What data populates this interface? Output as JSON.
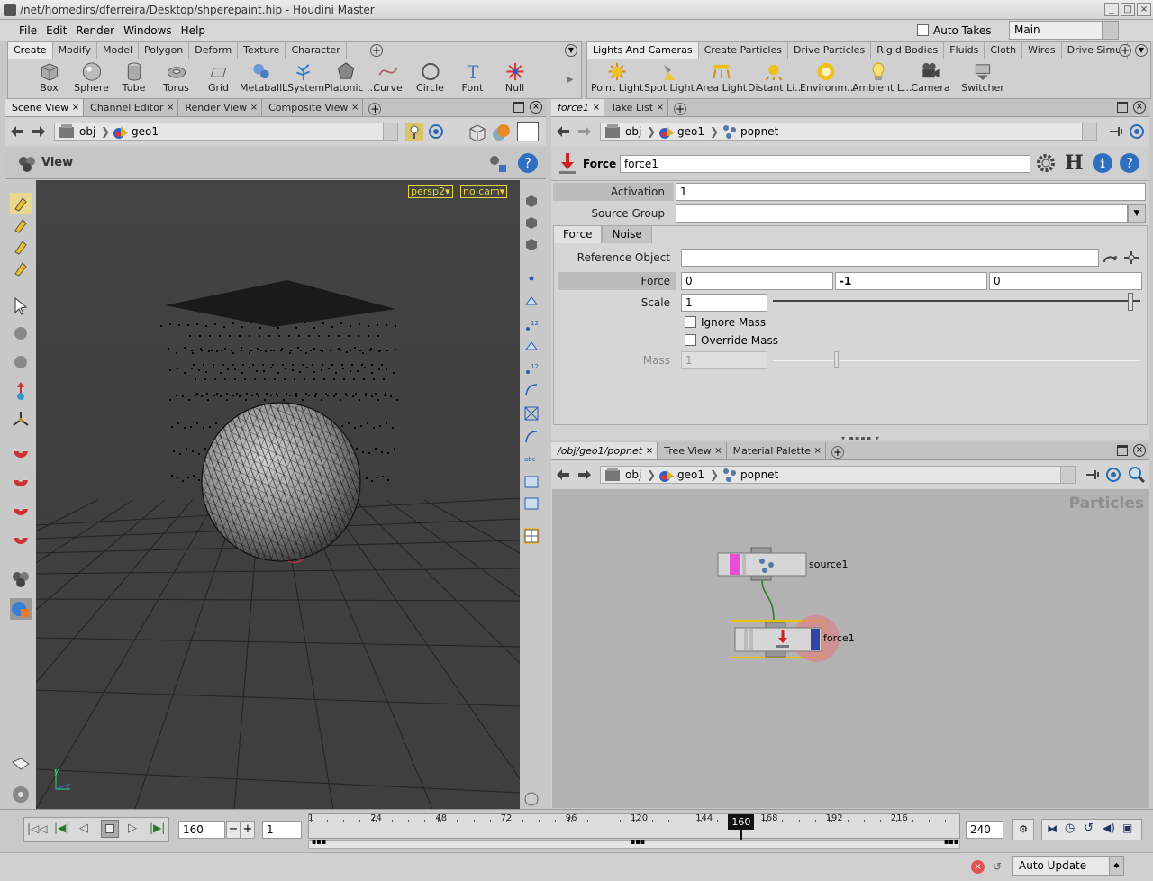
{
  "window": {
    "title": "/net/homedirs/dferreira/Desktop/shperepaint.hip - Houdini Master"
  },
  "menu": [
    "File",
    "Edit",
    "Render",
    "Windows",
    "Help"
  ],
  "auto_takes": "Auto Takes",
  "desktop": "Main",
  "shelf_left": {
    "tabs": [
      "Create",
      "Modify",
      "Model",
      "Polygon",
      "Deform",
      "Texture",
      "Character"
    ],
    "tools": [
      {
        "label": "Box",
        "icon": "box-icon"
      },
      {
        "label": "Sphere",
        "icon": "sphere-icon"
      },
      {
        "label": "Tube",
        "icon": "tube-icon"
      },
      {
        "label": "Torus",
        "icon": "torus-icon"
      },
      {
        "label": "Grid",
        "icon": "grid-icon"
      },
      {
        "label": "Metaball",
        "icon": "metaball-icon"
      },
      {
        "label": "LSystem",
        "icon": "lsystem-icon"
      },
      {
        "label": "Platonic ...",
        "icon": "platonic-icon"
      },
      {
        "label": "Curve",
        "icon": "curve-icon"
      },
      {
        "label": "Circle",
        "icon": "circle-icon"
      },
      {
        "label": "Font",
        "icon": "font-icon"
      },
      {
        "label": "Null",
        "icon": "null-icon"
      }
    ]
  },
  "shelf_right": {
    "tabs": [
      "Lights And Cameras",
      "Create Particles",
      "Drive Particles",
      "Rigid Bodies",
      "Fluids",
      "Cloth",
      "Wires",
      "Drive Simu"
    ],
    "tools": [
      {
        "label": "Point Light",
        "icon": "point-light-icon"
      },
      {
        "label": "Spot Light",
        "icon": "spot-light-icon"
      },
      {
        "label": "Area Light",
        "icon": "area-light-icon"
      },
      {
        "label": "Distant Li...",
        "icon": "distant-light-icon"
      },
      {
        "label": "Environm...",
        "icon": "environment-light-icon"
      },
      {
        "label": "Ambient L...",
        "icon": "ambient-light-icon"
      },
      {
        "label": "Camera",
        "icon": "camera-icon"
      },
      {
        "label": "Switcher",
        "icon": "switcher-icon"
      }
    ]
  },
  "scene_pane": {
    "tabs": [
      "Scene View",
      "Channel Editor",
      "Render View",
      "Composite View"
    ],
    "path": [
      "obj",
      "geo1"
    ],
    "view_label": "View",
    "camera_menus": [
      "persp2",
      "no cam"
    ],
    "axis": {
      "y": "y",
      "z": "z"
    }
  },
  "param_pane": {
    "tabs": [
      "force1",
      "Take List"
    ],
    "path": [
      "obj",
      "geo1",
      "popnet"
    ],
    "node_type": "Force",
    "node_name": "force1",
    "activation_label": "Activation",
    "activation_value": "1",
    "source_group_label": "Source Group",
    "source_group_value": "",
    "subtabs": [
      "Force",
      "Noise"
    ],
    "reference_object_label": "Reference Object",
    "reference_object_value": "",
    "force_label": "Force",
    "force_values": [
      "0",
      "-1",
      "0"
    ],
    "scale_label": "Scale",
    "scale_value": "1",
    "ignore_mass": "Ignore Mass",
    "override_mass": "Override Mass",
    "mass_label": "Mass",
    "mass_value": "1",
    "scale_slider": 0.98,
    "mass_slider": 0.17
  },
  "network_pane": {
    "tabs": [
      "/obj/geo1/popnet",
      "Tree View",
      "Material Palette"
    ],
    "path": [
      "obj",
      "geo1",
      "popnet"
    ],
    "context_label": "Particles",
    "nodes": [
      {
        "name": "source1"
      },
      {
        "name": "force1"
      }
    ]
  },
  "timeline": {
    "current_frame": "160",
    "step": "1",
    "end_frame": "240",
    "ticks": [
      "1",
      "24",
      "48",
      "72",
      "96",
      "120",
      "144",
      "168",
      "192",
      "216"
    ],
    "marker": "160",
    "range_min": 1,
    "range_max": 240
  },
  "status": {
    "update_mode": "Auto Update"
  }
}
